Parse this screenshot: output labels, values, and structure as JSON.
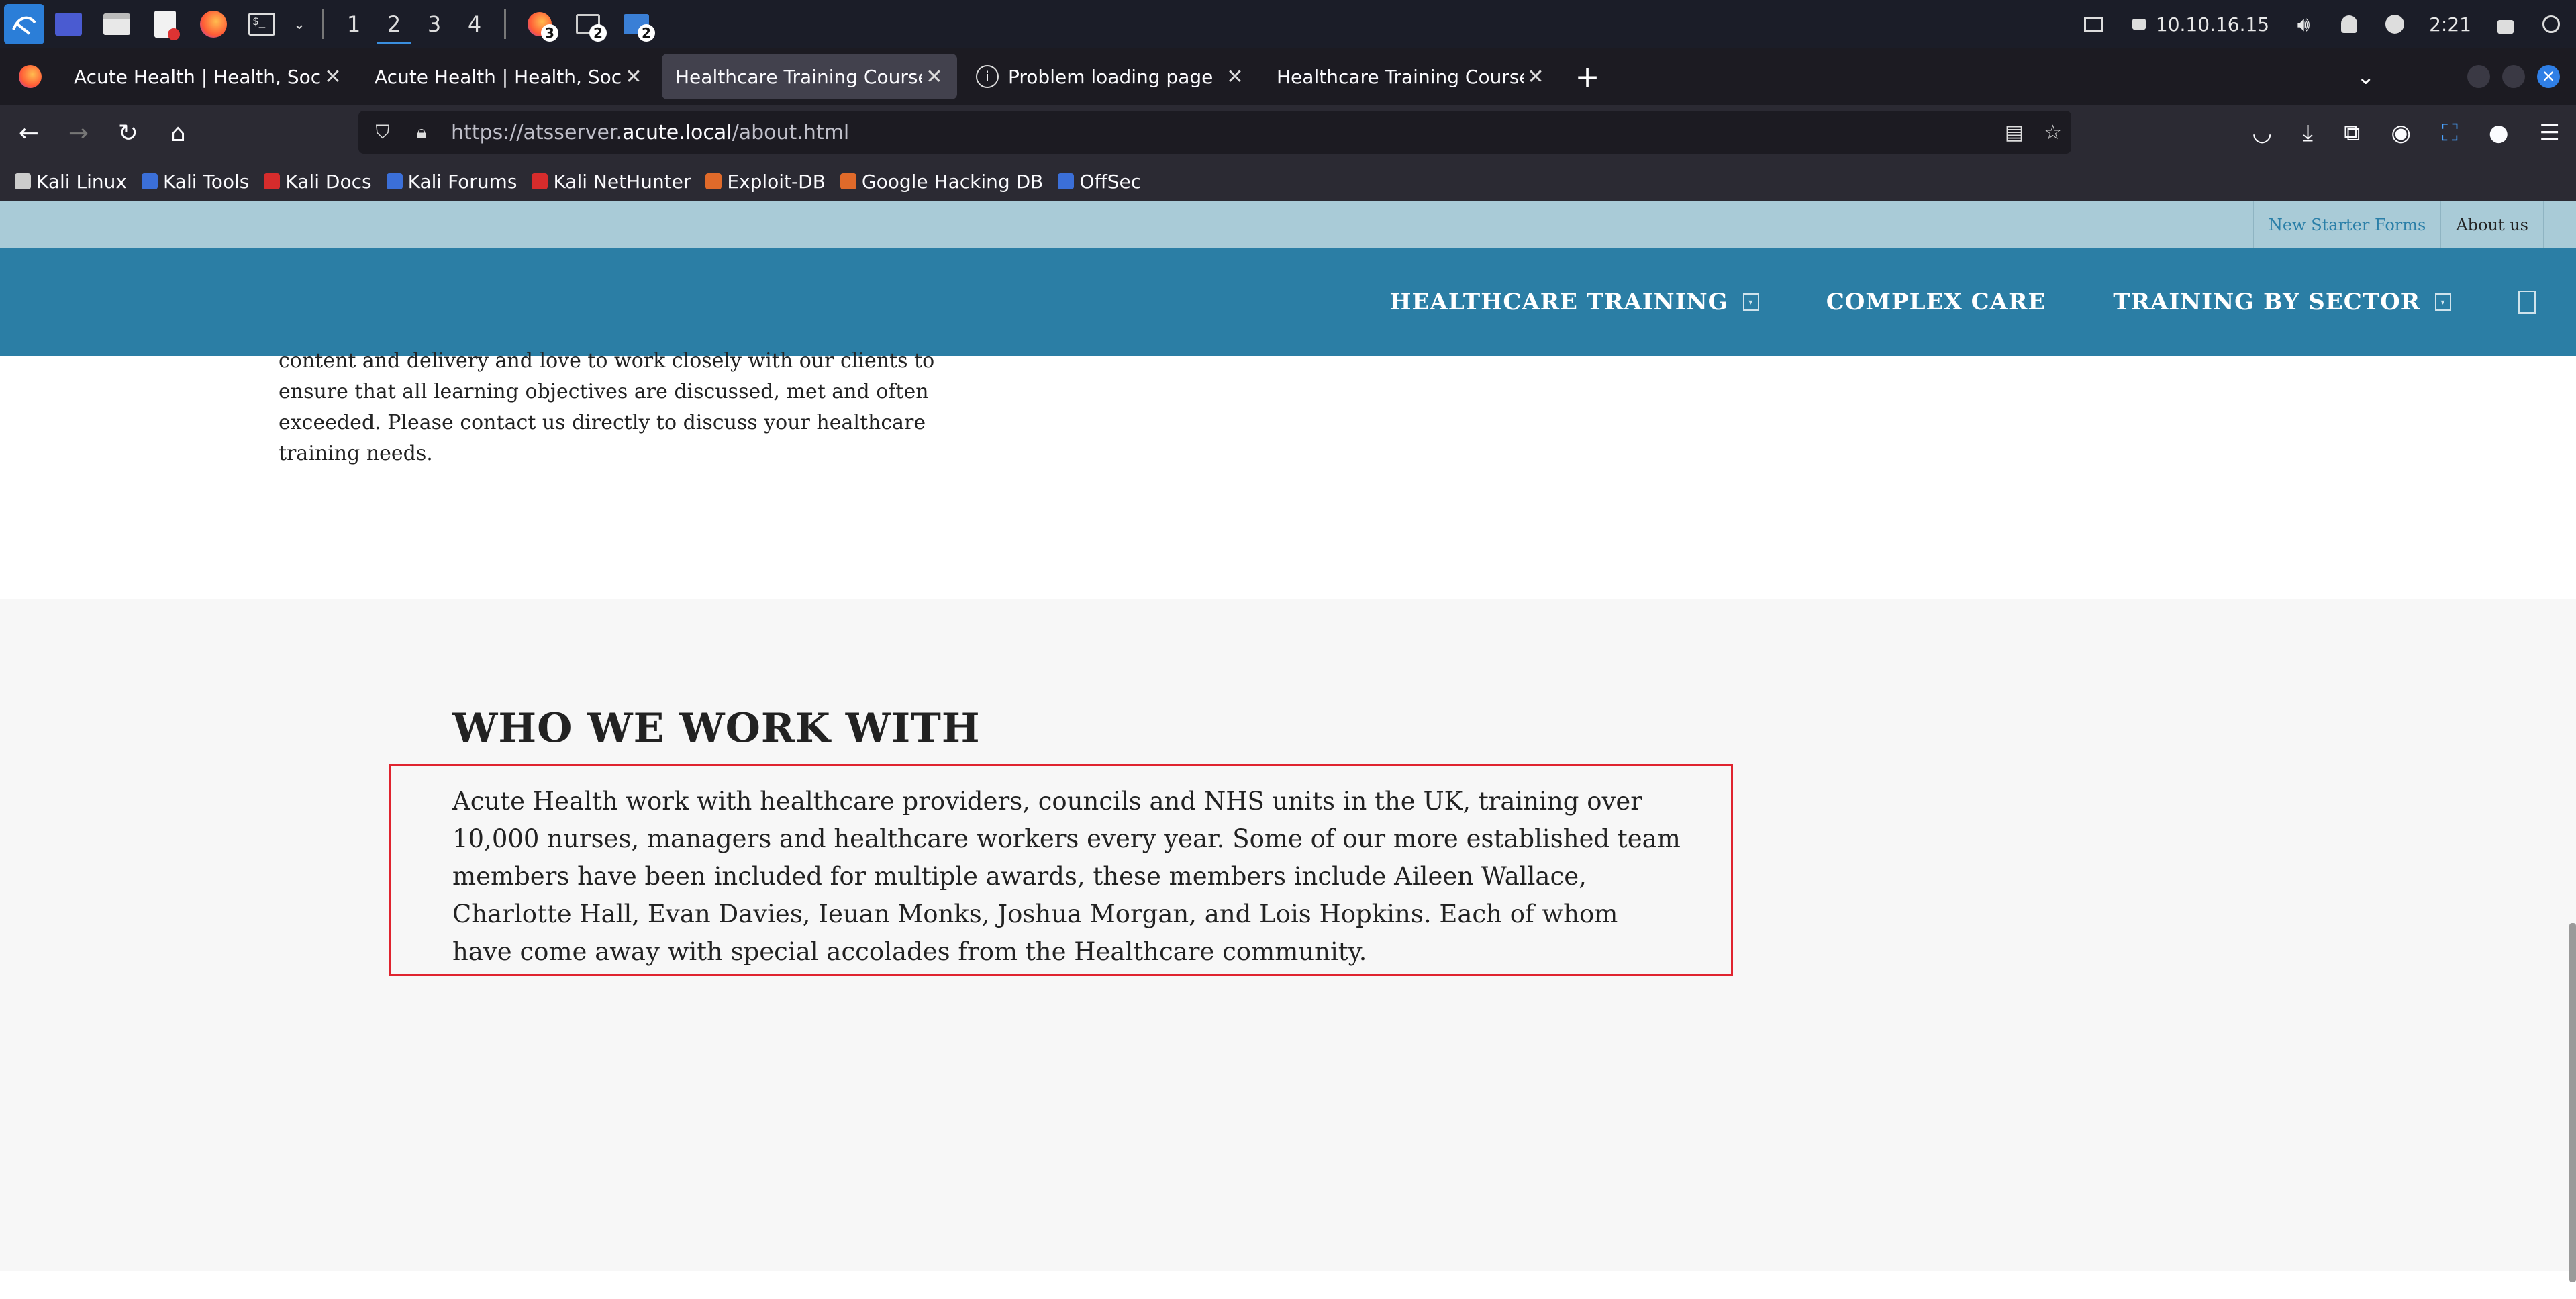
{
  "taskbar": {
    "workspaces": [
      "1",
      "2",
      "3",
      "4"
    ],
    "active_workspace": "2",
    "app_badges": [
      "3",
      "2",
      "2"
    ],
    "ip": "10.10.16.15",
    "clock": "2:21"
  },
  "tabs": [
    {
      "label": "Acute Health | Health, Social",
      "active": false
    },
    {
      "label": "Acute Health | Health, Social",
      "active": false
    },
    {
      "label": "Healthcare Training Courses",
      "active": true
    },
    {
      "label": "Problem loading page",
      "active": false
    },
    {
      "label": "Healthcare Training Courses",
      "active": false
    }
  ],
  "url": {
    "scheme": "https://atsserver.",
    "host": "acute.local",
    "path": "/about.html"
  },
  "bookmarks": [
    {
      "label": "Kali Linux",
      "color": "#cccccc"
    },
    {
      "label": "Kali Tools",
      "color": "#3b6fd8"
    },
    {
      "label": "Kali Docs",
      "color": "#d62c2c"
    },
    {
      "label": "Kali Forums",
      "color": "#3b6fd8"
    },
    {
      "label": "Kali NetHunter",
      "color": "#d62c2c"
    },
    {
      "label": "Exploit-DB",
      "color": "#e06a2a"
    },
    {
      "label": "Google Hacking DB",
      "color": "#e06a2a"
    },
    {
      "label": "OffSec",
      "color": "#3b6fd8"
    }
  ],
  "site": {
    "topbar_links": {
      "new_starter": "New Starter Forms",
      "about": "About us"
    },
    "nav": {
      "healthcare_training": "HEALTHCARE TRAINING",
      "complex_care": "COMPLEX CARE",
      "training_by_sector": "TRAINING BY SECTOR"
    },
    "intro_text": "content and delivery and love to work closely with our clients to ensure that all learning objectives are discussed, met and often exceeded. Please contact us directly to discuss your healthcare training needs.",
    "who_heading": "WHO WE WORK WITH",
    "who_text": "Acute Health work with healthcare providers, councils and NHS units in the UK, training over 10,000 nurses, managers and healthcare workers every year. Some of our more established team members have been included for multiple awards, these members include Aileen Wallace, Charlotte Hall, Evan Davies, Ieuan Monks, Joshua Morgan, and Lois Hopkins. Each of whom have come away with special accolades from the Healthcare community."
  },
  "colors": {
    "nav_bg": "#2b7ea5",
    "topbar_bg": "#a9cbd7",
    "highlight": "#e0242f"
  }
}
